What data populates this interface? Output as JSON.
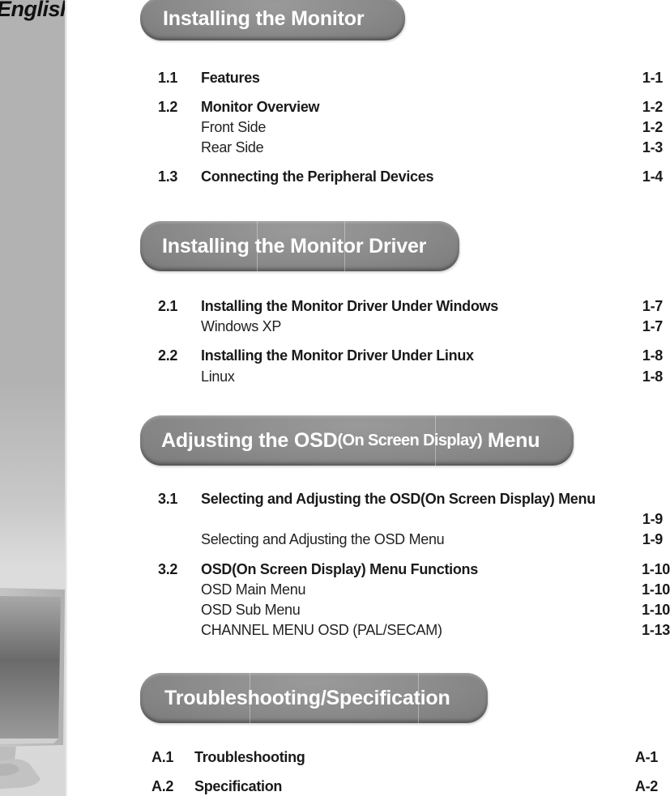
{
  "sidebar": {
    "language_label": "English",
    "illustration": "monitor-illustration"
  },
  "sections": [
    {
      "header": "Installing the Monitor",
      "entries": [
        {
          "num": "1.1",
          "title": "Features",
          "page": "1-1",
          "level": "main"
        },
        {
          "num": "1.2",
          "title": "Monitor Overview",
          "page": "1-2",
          "level": "main"
        },
        {
          "num": "",
          "title": "Front Side",
          "page": "1-2",
          "level": "sub"
        },
        {
          "num": "",
          "title": "Rear Side",
          "page": "1-3",
          "level": "sub"
        },
        {
          "num": "1.3",
          "title": "Connecting the Peripheral Devices",
          "page": "1-4",
          "level": "main"
        }
      ]
    },
    {
      "header": "Installing the Monitor Driver",
      "entries": [
        {
          "num": "2.1",
          "title": "Installing the Monitor Driver Under Windows",
          "page": "1-7",
          "level": "main"
        },
        {
          "num": "",
          "title": "Windows XP",
          "page": "1-7",
          "level": "sub"
        },
        {
          "num": "2.2",
          "title": "Installing the Monitor Driver Under Linux",
          "page": "1-8",
          "level": "main"
        },
        {
          "num": "",
          "title": "Linux",
          "page": "1-8",
          "level": "sub"
        }
      ]
    },
    {
      "header_main": "Adjusting the OSD",
      "header_small": "(On Screen Display)",
      "header_end": " Menu",
      "entries": [
        {
          "num": "3.1",
          "title": "Selecting and Adjusting the OSD(On Screen Display) Menu",
          "page": "",
          "level": "main"
        },
        {
          "num": "",
          "title": "",
          "page": "1-9",
          "level": "continuation"
        },
        {
          "num": "",
          "title": "Selecting and Adjusting the OSD Menu",
          "page": "1-9",
          "level": "sub"
        },
        {
          "num": "3.2",
          "title": "OSD(On Screen Display) Menu Functions",
          "page": "1-10",
          "level": "main"
        },
        {
          "num": "",
          "title": "OSD Main Menu",
          "page": "1-10",
          "level": "sub"
        },
        {
          "num": "",
          "title": "OSD Sub Menu",
          "page": "1-10",
          "level": "sub"
        },
        {
          "num": "",
          "title": "CHANNEL MENU OSD (PAL/SECAM)",
          "page": "1-13",
          "level": "sub"
        }
      ]
    },
    {
      "header": "Troubleshooting/Specification",
      "entries": [
        {
          "num": "A.1",
          "title": "Troubleshooting",
          "page": "A-1",
          "level": "main"
        },
        {
          "num": "A.2",
          "title": "Specification",
          "page": "A-2",
          "level": "main"
        }
      ]
    }
  ],
  "colors": {
    "pill": "#8a8a8a",
    "sidebar": "#b2b2b2",
    "text": "#1a1a1a"
  }
}
